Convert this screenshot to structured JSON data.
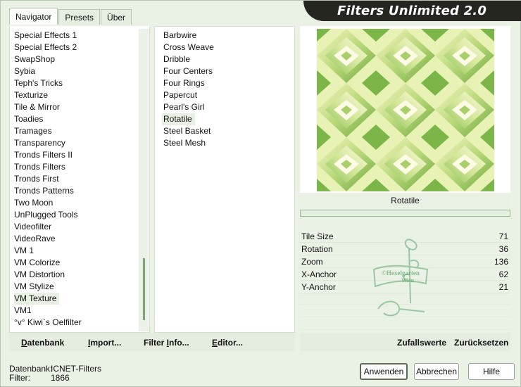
{
  "window": {
    "title": "Filters Unlimited 2.0"
  },
  "tabs": [
    {
      "label": "Navigator",
      "active": true
    },
    {
      "label": "Presets",
      "active": false
    },
    {
      "label": "Über",
      "active": false
    }
  ],
  "categories": [
    "Special Effects 1",
    "Special Effects 2",
    "SwapShop",
    "Sybia",
    "Teph's Tricks",
    "Texturize",
    "Tile & Mirror",
    "Toadies",
    "Tramages",
    "Transparency",
    "Tronds Filters II",
    "Tronds Filters",
    "Tronds First",
    "Tronds Patterns",
    "Two Moon",
    "UnPlugged Tools",
    "Videofilter",
    "VideoRave",
    "VM 1",
    "VM Colorize",
    "VM Distortion",
    "VM Stylize",
    "VM Texture",
    "VM1",
    "°v° Kiwi`s Oelfilter"
  ],
  "selected_category": "VM Texture",
  "filters": [
    "Barbwire",
    "Cross Weave",
    "Dribble",
    "Four Centers",
    "Four Rings",
    "Papercut",
    "Pearl's Girl",
    "Rotatile",
    "Steel Basket",
    "Steel Mesh"
  ],
  "selected_filter": "Rotatile",
  "bottom_buttons": {
    "datenbank": {
      "first": "D",
      "rest": "atenbank"
    },
    "import": {
      "first": "I",
      "rest": "mport..."
    },
    "filter_info": {
      "pre": "Filter ",
      "first": "I",
      "rest": "nfo..."
    },
    "editor": {
      "first": "E",
      "rest": "ditor..."
    }
  },
  "current_filter_name": "Rotatile",
  "params": [
    {
      "label": "Tile Size",
      "value": "71"
    },
    {
      "label": "Rotation",
      "value": "36"
    },
    {
      "label": "Zoom",
      "value": "136"
    },
    {
      "label": "X-Anchor",
      "value": "62"
    },
    {
      "label": "Y-Anchor",
      "value": "21"
    }
  ],
  "random_button": "Zufallswerte",
  "reset_button": "Zurücksetzen",
  "status": {
    "db_label": "Datenbank:",
    "db_value": "ICNET-Filters",
    "filter_label": "Filter:",
    "filter_value": "1866"
  },
  "buttons": {
    "apply": "Anwenden",
    "cancel": "Abbrechen",
    "help": "Hilfe"
  },
  "watermark": "©Hexelgarten Wien",
  "colors": {
    "accent_green": "#7da66e",
    "banner": "#24261f",
    "preview_light": "#f6f4b8",
    "preview_green": "#8fc05a"
  }
}
